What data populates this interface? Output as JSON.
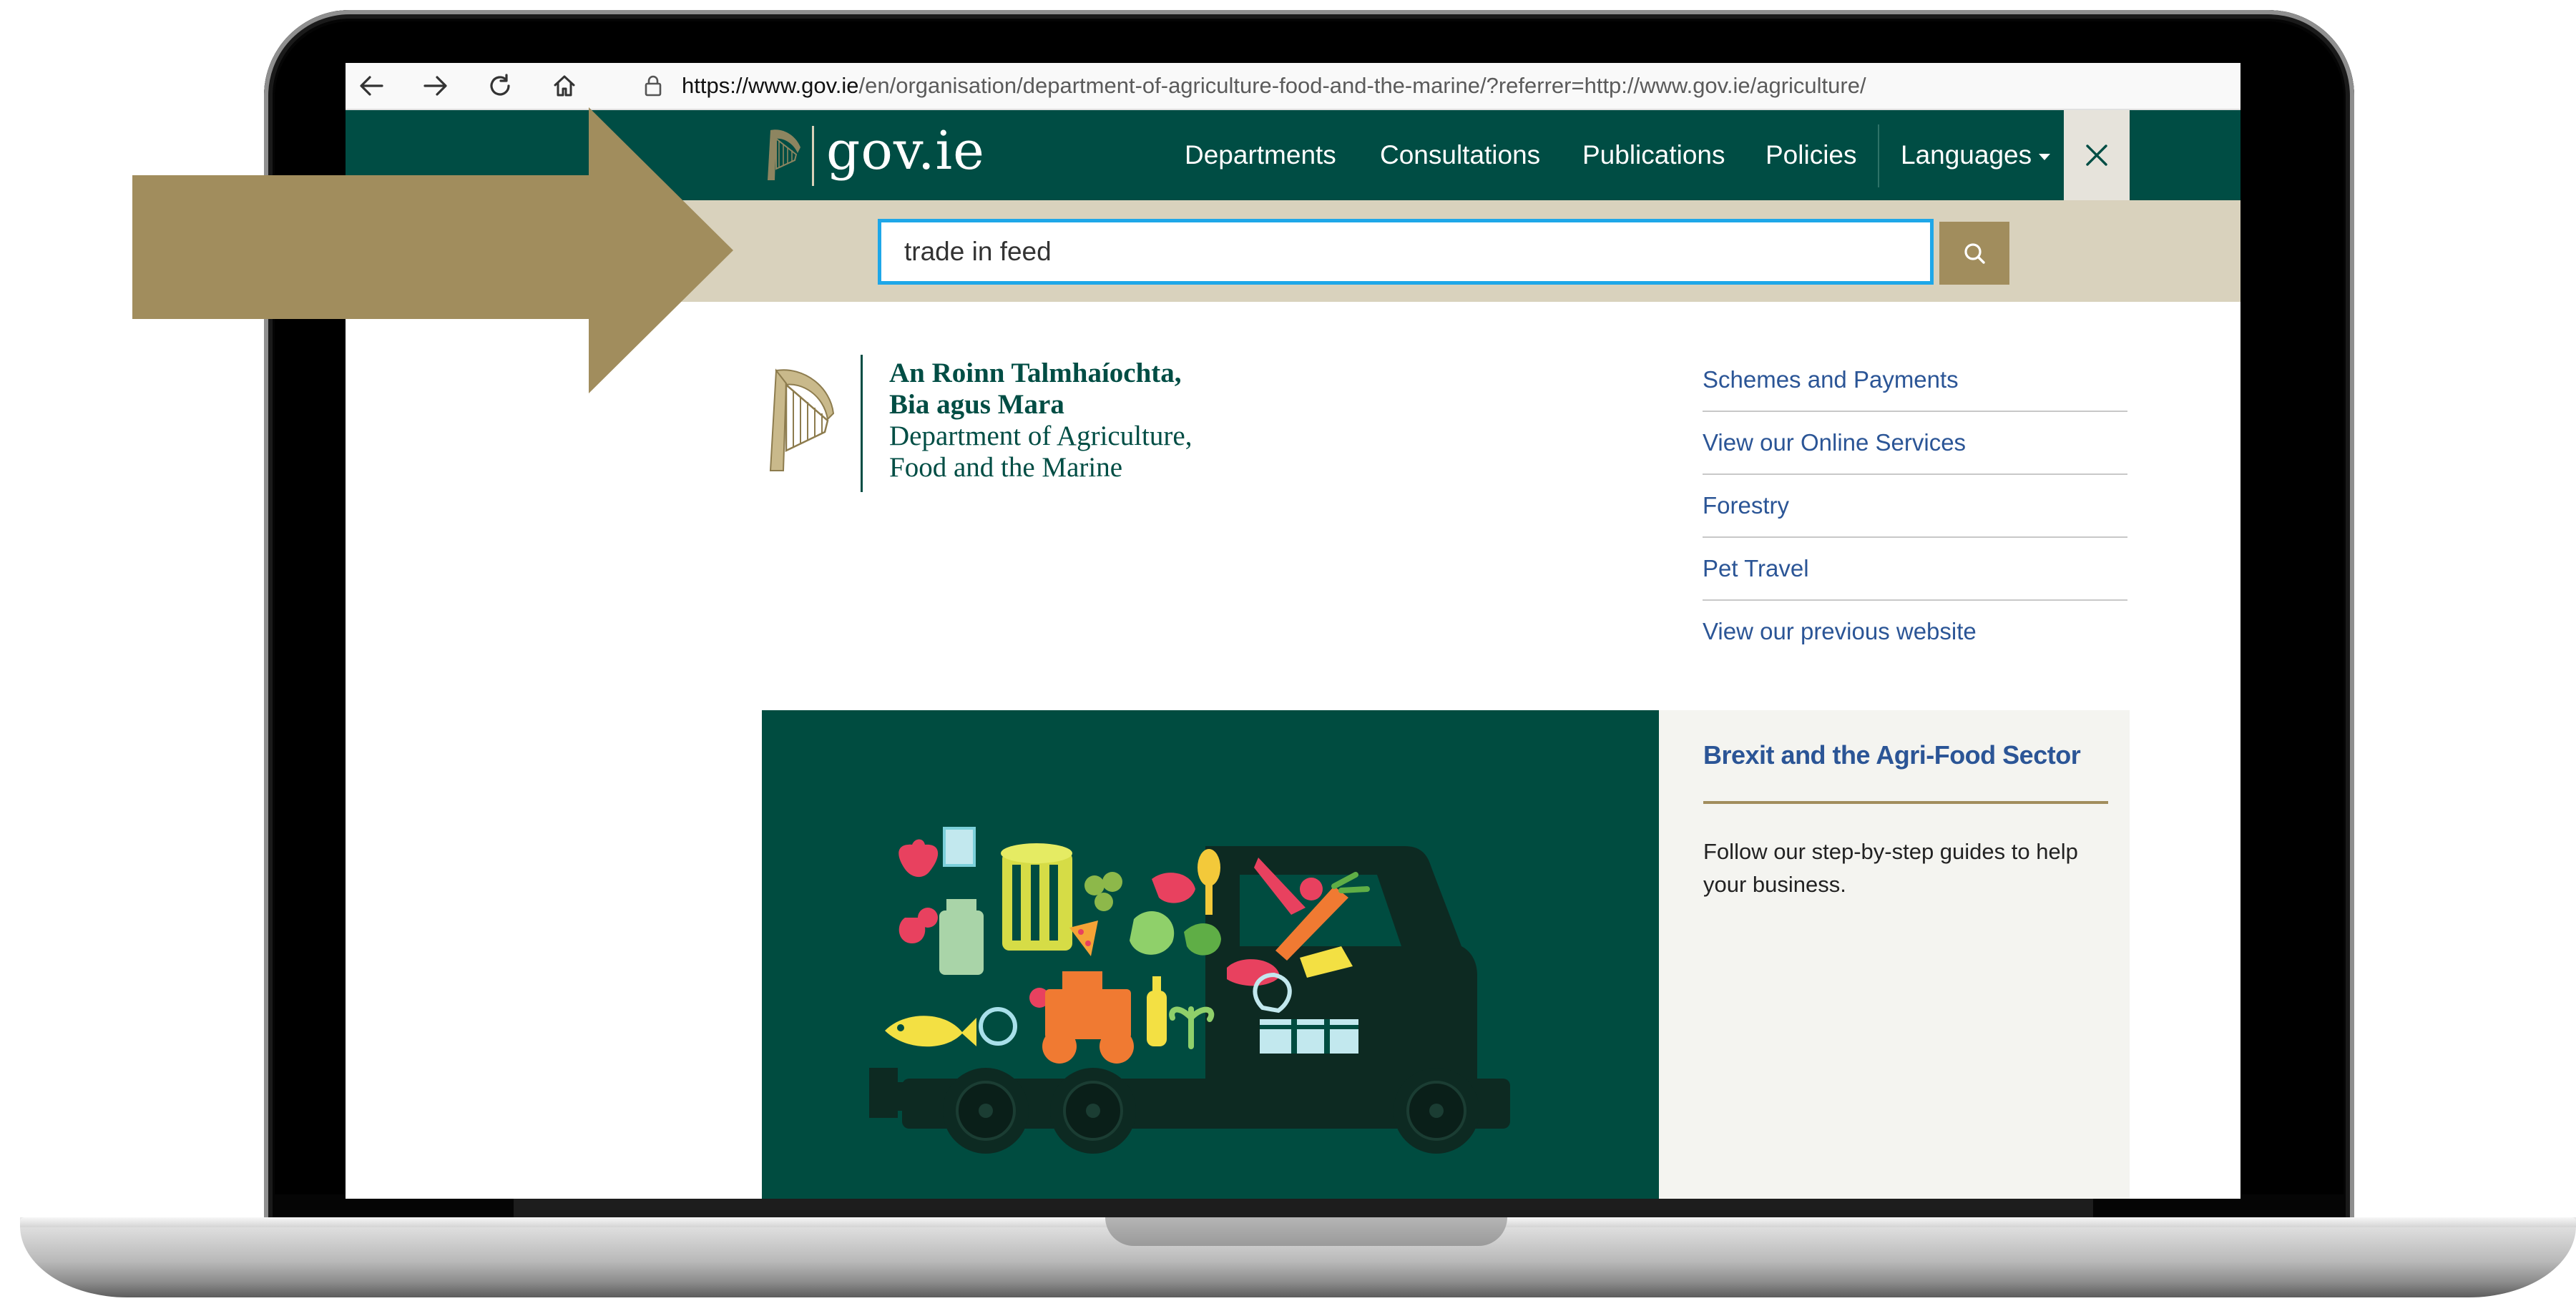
{
  "browser": {
    "url_host_prefix": "https://www.gov.ie",
    "url_path": "/en/organisation/department-of-agriculture-food-and-the-marine/?referrer=http://www.gov.ie/agriculture/"
  },
  "header": {
    "logo_text": "gov.ie",
    "nav": [
      "Departments",
      "Consultations",
      "Publications",
      "Policies"
    ],
    "languages_label": "Languages"
  },
  "search": {
    "value": "trade in feed"
  },
  "department": {
    "name_irish_line1": "An Roinn Talmhaíochta,",
    "name_irish_line2": "Bia agus Mara",
    "name_english_line1": "Department of Agriculture,",
    "name_english_line2": "Food and the Marine"
  },
  "quick_links": [
    "Schemes and Payments",
    "View our Online Services",
    "Forestry",
    "Pet Travel",
    "View our previous website"
  ],
  "feature": {
    "title": "Brexit and the Agri-Food Sector",
    "description": "Follow our step-by-step guides to help your business."
  },
  "colors": {
    "header_green": "#004d44",
    "search_band": "#d9d2bd",
    "accent_gold": "#a18d5d",
    "link_blue": "#2b5596",
    "focus_blue": "#1ea7e8"
  }
}
